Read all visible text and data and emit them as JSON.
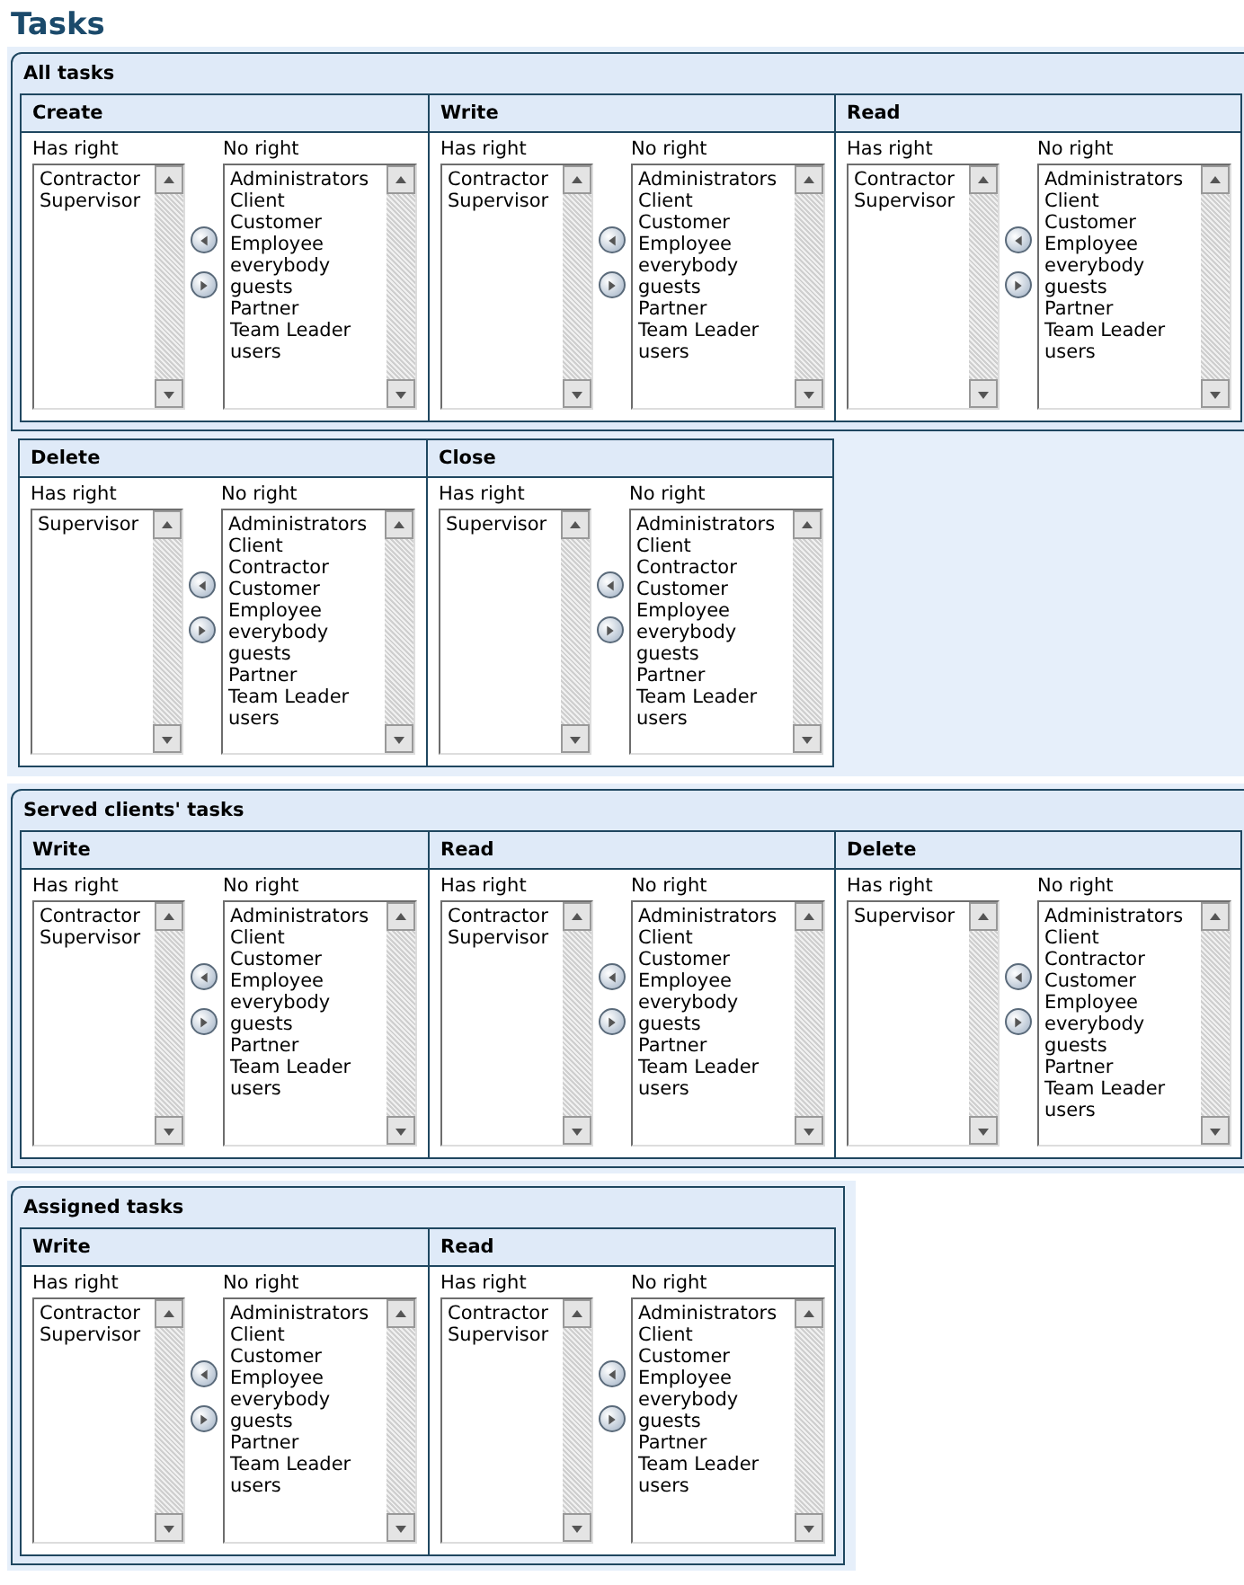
{
  "title": "Tasks",
  "sections": [
    {
      "title": "All tasks",
      "rows": [
        [
          {
            "title": "Create",
            "has_label": "Has right",
            "has": [
              "Contractor",
              "Supervisor"
            ],
            "no_label": "No right",
            "no": [
              "Administrators",
              "Client",
              "Customer",
              "Employee",
              "everybody",
              "guests",
              "Partner",
              "Team Leader",
              "users"
            ]
          },
          {
            "title": "Write",
            "has_label": "Has right",
            "has": [
              "Contractor",
              "Supervisor"
            ],
            "no_label": "No right",
            "no": [
              "Administrators",
              "Client",
              "Customer",
              "Employee",
              "everybody",
              "guests",
              "Partner",
              "Team Leader",
              "users"
            ]
          },
          {
            "title": "Read",
            "has_label": "Has right",
            "has": [
              "Contractor",
              "Supervisor"
            ],
            "no_label": "No right",
            "no": [
              "Administrators",
              "Client",
              "Customer",
              "Employee",
              "everybody",
              "guests",
              "Partner",
              "Team Leader",
              "users"
            ]
          }
        ],
        [
          {
            "title": "Delete",
            "has_label": "Has right",
            "has": [
              "Supervisor"
            ],
            "no_label": "No right",
            "no": [
              "Administrators",
              "Client",
              "Contractor",
              "Customer",
              "Employee",
              "everybody",
              "guests",
              "Partner",
              "Team Leader",
              "users"
            ]
          },
          {
            "title": "Close",
            "has_label": "Has right",
            "has": [
              "Supervisor"
            ],
            "no_label": "No right",
            "no": [
              "Administrators",
              "Client",
              "Contractor",
              "Customer",
              "Employee",
              "everybody",
              "guests",
              "Partner",
              "Team Leader",
              "users"
            ]
          }
        ]
      ]
    },
    {
      "title": "Served clients' tasks",
      "rows": [
        [
          {
            "title": "Write",
            "has_label": "Has right",
            "has": [
              "Contractor",
              "Supervisor"
            ],
            "no_label": "No right",
            "no": [
              "Administrators",
              "Client",
              "Customer",
              "Employee",
              "everybody",
              "guests",
              "Partner",
              "Team Leader",
              "users"
            ]
          },
          {
            "title": "Read",
            "has_label": "Has right",
            "has": [
              "Contractor",
              "Supervisor"
            ],
            "no_label": "No right",
            "no": [
              "Administrators",
              "Client",
              "Customer",
              "Employee",
              "everybody",
              "guests",
              "Partner",
              "Team Leader",
              "users"
            ]
          },
          {
            "title": "Delete",
            "has_label": "Has right",
            "has": [
              "Supervisor"
            ],
            "no_label": "No right",
            "no": [
              "Administrators",
              "Client",
              "Contractor",
              "Customer",
              "Employee",
              "everybody",
              "guests",
              "Partner",
              "Team Leader",
              "users"
            ]
          }
        ]
      ]
    },
    {
      "title": "Assigned tasks",
      "rows": [
        [
          {
            "title": "Write",
            "has_label": "Has right",
            "has": [
              "Contractor",
              "Supervisor"
            ],
            "no_label": "No right",
            "no": [
              "Administrators",
              "Client",
              "Customer",
              "Employee",
              "everybody",
              "guests",
              "Partner",
              "Team Leader",
              "users"
            ]
          },
          {
            "title": "Read",
            "has_label": "Has right",
            "has": [
              "Contractor",
              "Supervisor"
            ],
            "no_label": "No right",
            "no": [
              "Administrators",
              "Client",
              "Customer",
              "Employee",
              "everybody",
              "guests",
              "Partner",
              "Team Leader",
              "users"
            ]
          }
        ]
      ]
    }
  ]
}
